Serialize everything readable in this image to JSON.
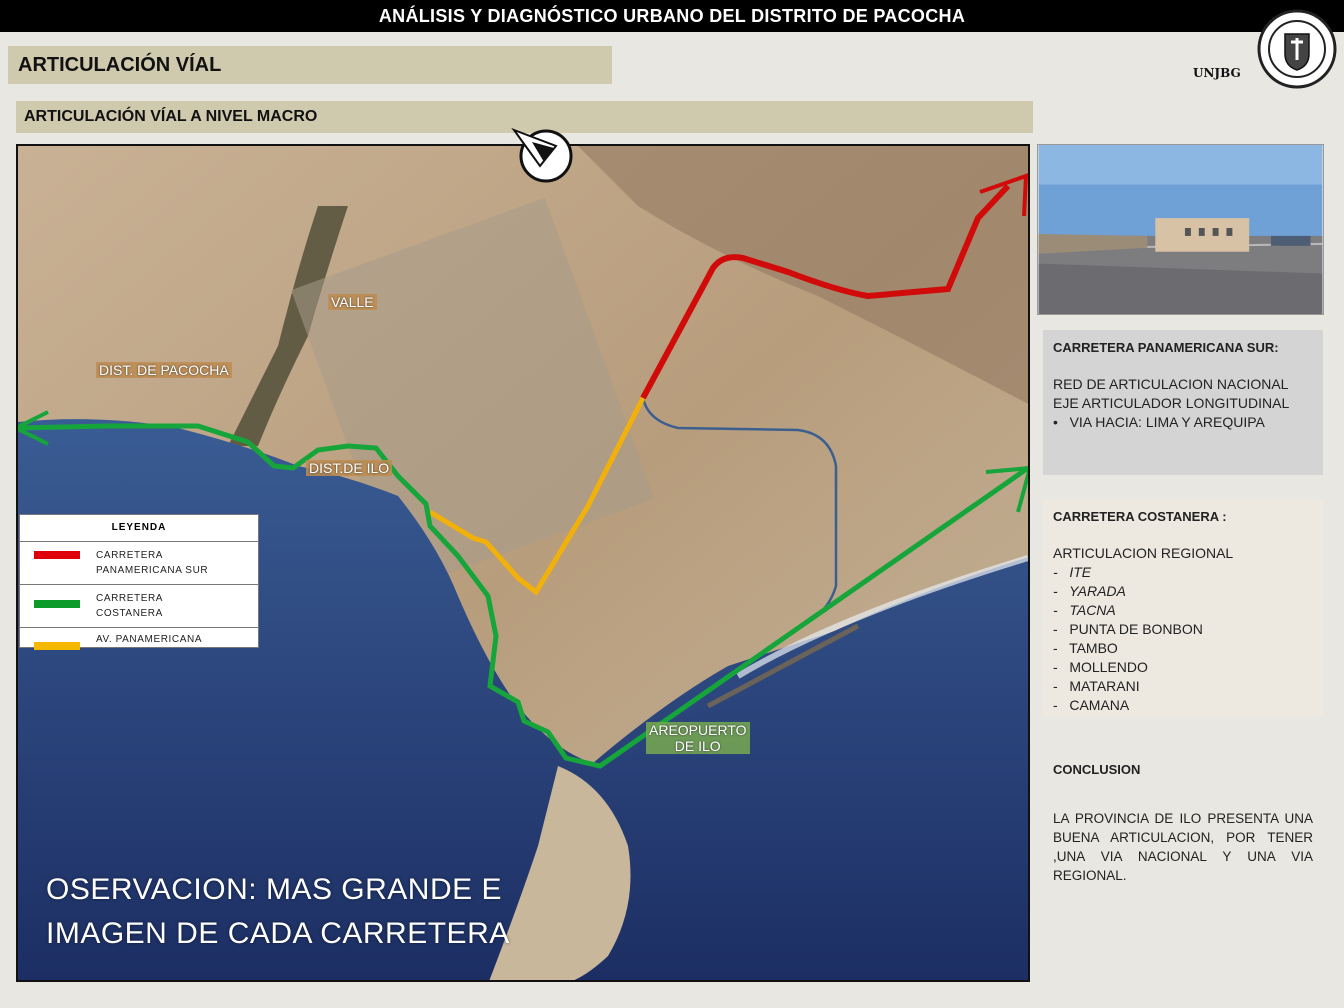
{
  "header": {
    "title": "ANÁLISIS Y DIAGNÓSTICO URBANO DEL DISTRITO DE PACOCHA",
    "section": "ARTICULACIÓN VÍAL",
    "subsection": "ARTICULACIÓN VÍAL A NIVEL MACRO",
    "university": "UNJBG"
  },
  "map": {
    "places": {
      "valle": "VALLE",
      "pacocha": "DIST. DE PACOCHA",
      "ilo": "DIST.DE ILO",
      "airport_line1": "AREOPUERTO",
      "airport_line2": "DE ILO"
    },
    "legend": {
      "title": "LEYENDA",
      "items": [
        {
          "label": "CARRETERA PANAMERICANA SUR",
          "color": "#e0000b"
        },
        {
          "label": "CARRETERA COSTANERA",
          "color": "#0c9a2a"
        },
        {
          "label": "AV. PANAMERICANA",
          "color": "#f5b800"
        }
      ]
    },
    "observation_line1": "OSERVACION: MAS GRANDE E",
    "observation_line2": "IMAGEN DE CADA CARRETERA",
    "route_colors": {
      "panamericana_sur": "#d10a0a",
      "costanera": "#16a53a",
      "av_panamericana": "#f2b10a",
      "other": "#3c5f8f"
    }
  },
  "sidebar": {
    "panamericana": {
      "title": "CARRETERA PANAMERICANA SUR:",
      "lines": [
        "RED DE ARTICULACION NACIONAL",
        "EJE ARTICULADOR LONGITUDINAL"
      ],
      "bullet": "VIA HACIA: LIMA  Y  AREQUIPA"
    },
    "costanera": {
      "title": "CARRETERA COSTANERA :",
      "intro": "ARTICULACION REGIONAL",
      "items": [
        "ITE",
        "YARADA",
        "TACNA",
        "PUNTA DE BONBON",
        "TAMBO",
        "MOLLENDO",
        "MATARANI",
        "CAMANA"
      ]
    },
    "conclusion": {
      "title": "CONCLUSION",
      "text": "LA PROVINCIA  DE ILO PRESENTA UNA BUENA ARTICULACION, POR TENER ,UNA VIA NACIONAL Y UNA VIA REGIONAL."
    }
  }
}
